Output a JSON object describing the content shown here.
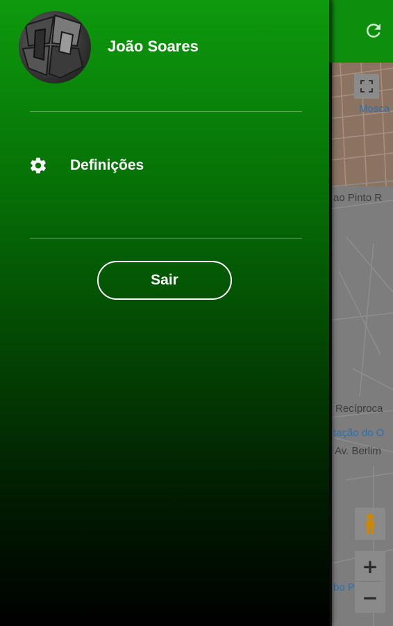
{
  "app": {
    "refresh_icon": "refresh-icon",
    "map": {
      "labels": {
        "street_top": "ao Pinto R",
        "city": "Mosca",
        "reciprocal": "Recíproca",
        "station": "tação do O",
        "avenue": "Av. Berlim",
        "bottom_place": "bo P"
      },
      "zoom_in": "+",
      "zoom_out": "−",
      "icons": [
        "fullscreen-icon",
        "pegman-icon"
      ]
    },
    "colors": {
      "header": "#0d8f0d",
      "map_overlay": "#7d7d7d"
    }
  },
  "drawer": {
    "user": {
      "name": "João Soares"
    },
    "menu": [
      {
        "label": "Definições",
        "icon": "gear-icon"
      }
    ],
    "logout_label": "Sair",
    "colors": {
      "gradient_top": "#0e9a0e",
      "gradient_bottom": "#000000",
      "text": "#ffffff"
    }
  }
}
